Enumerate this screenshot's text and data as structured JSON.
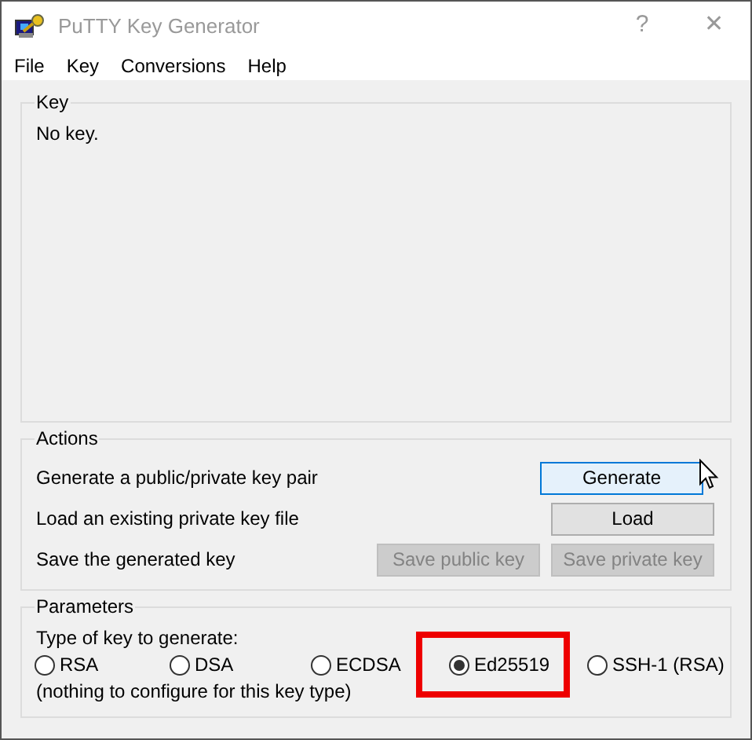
{
  "window": {
    "title": "PuTTY Key Generator",
    "buttons": [
      "?",
      "✕"
    ]
  },
  "menu": [
    "File",
    "Key",
    "Conversions",
    "Help"
  ],
  "key_group": {
    "title": "Key",
    "text": "No key."
  },
  "actions": {
    "title": "Actions",
    "rows": [
      {
        "label": "Generate a public/private key pair",
        "buttons": [
          {
            "label": "Generate",
            "disabled": false,
            "hovered": true
          }
        ]
      },
      {
        "label": "Load an existing private key file",
        "buttons": [
          {
            "label": "Load",
            "disabled": false,
            "hovered": false
          }
        ]
      },
      {
        "label": "Save the generated key",
        "buttons": [
          {
            "label": "Save public key",
            "disabled": true,
            "hovered": false
          },
          {
            "label": "Save private key",
            "disabled": true,
            "hovered": false
          }
        ]
      }
    ]
  },
  "parameters": {
    "title": "Parameters",
    "type_label": "Type of key to generate:",
    "options": [
      {
        "label": "RSA",
        "selected": false,
        "highlighted": false
      },
      {
        "label": "DSA",
        "selected": false,
        "highlighted": false
      },
      {
        "label": "ECDSA",
        "selected": false,
        "highlighted": false
      },
      {
        "label": "Ed25519",
        "selected": true,
        "highlighted": true
      },
      {
        "label": "SSH-1 (RSA)",
        "selected": false,
        "highlighted": false
      }
    ],
    "note": "(nothing to configure for this key type)"
  }
}
